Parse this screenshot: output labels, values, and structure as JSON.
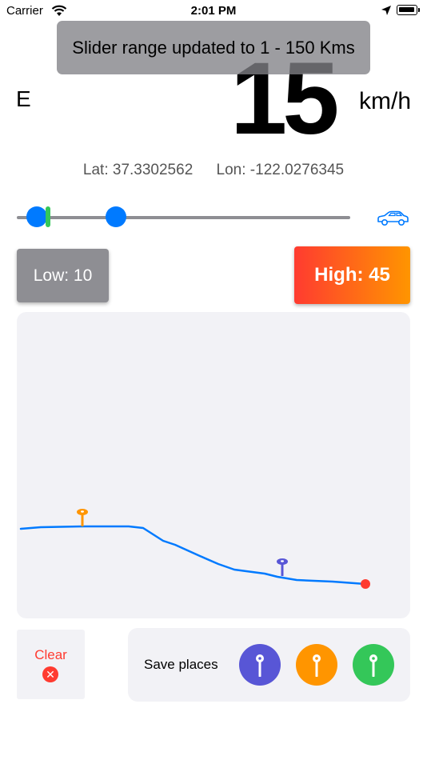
{
  "status_bar": {
    "carrier": "Carrier",
    "time": "2:01 PM"
  },
  "toast": {
    "message": "Slider range updated to 1 - 150 Kms"
  },
  "speed": {
    "heading": "E",
    "value": "15",
    "unit": "km/h"
  },
  "location": {
    "lat": "Lat: 37.3302562",
    "lon": "Lon: -122.0276345"
  },
  "slider": {
    "min": 1,
    "max": 150,
    "low": 10,
    "high": 45,
    "current": 15
  },
  "buttons": {
    "low_label": "Low: 10",
    "high_label": "High: 45"
  },
  "controls": {
    "clear_label": "Clear",
    "save_places_label": "Save places"
  },
  "colors": {
    "accent": "#007aff",
    "slider_marker": "#34c759",
    "low_button": "#8e8e93",
    "high_gradient_start": "#ff3b30",
    "high_gradient_end": "#ff9500",
    "route": "#007aff",
    "route_end": "#ff3b30",
    "pin_purple": "#5856d6",
    "pin_orange": "#ff9500",
    "pin_green": "#34c759"
  },
  "icons": [
    "wifi-icon",
    "location-arrow-icon",
    "battery-icon",
    "car-icon",
    "map-pin-icon",
    "clear-x-icon"
  ]
}
